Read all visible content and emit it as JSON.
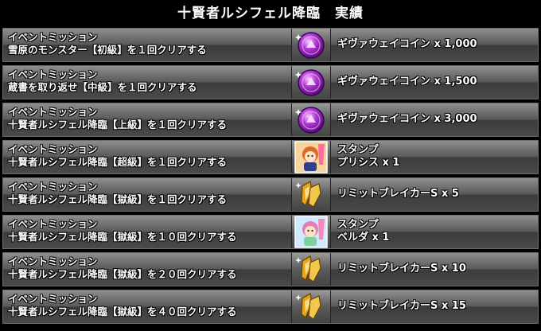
{
  "title": "十賢者ルシフェル降臨　実績",
  "rows": [
    {
      "line1": "イベントミッション",
      "line2": "雪原のモンスター【初級】を１回クリアする",
      "icon": "purple-coin-icon",
      "reward": [
        "ギヴァウェイコイン x 1,000"
      ]
    },
    {
      "line1": "イベントミッション",
      "line2": "蔵書を取り返せ【中級】を１回クリアする",
      "icon": "purple-coin-icon",
      "reward": [
        "ギヴァウェイコイン x 1,500"
      ]
    },
    {
      "line1": "イベントミッション",
      "line2": "十賢者ルシフェル降臨【上級】を１回クリアする",
      "icon": "purple-coin-icon",
      "reward": [
        "ギヴァウェイコイン x 3,000"
      ]
    },
    {
      "line1": "イベントミッション",
      "line2": "十賢者ルシフェル降臨【超級】を１回クリアする",
      "icon": "stamp-pricis-icon",
      "reward": [
        "スタンプ",
        "プリシス x 1"
      ]
    },
    {
      "line1": "イベントミッション",
      "line2": "十賢者ルシフェル降臨【獄級】を１回クリアする",
      "icon": "limit-breaker-icon",
      "reward": [
        "リミットブレイカーS x 5"
      ]
    },
    {
      "line1": "イベントミッション",
      "line2": "十賢者ルシフェル降臨【獄級】を１０回クリアする",
      "icon": "stamp-belda-icon",
      "reward": [
        "スタンプ",
        "ベルダ x 1"
      ]
    },
    {
      "line1": "イベントミッション",
      "line2": "十賢者ルシフェル降臨【獄級】を２０回クリアする",
      "icon": "limit-breaker-icon",
      "reward": [
        "リミットブレイカーS x 10"
      ]
    },
    {
      "line1": "イベントミッション",
      "line2": "十賢者ルシフェル降臨【獄級】を４０回クリアする",
      "icon": "limit-breaker-icon",
      "reward": [
        "リミットブレイカーS x 15"
      ]
    }
  ],
  "colors": {
    "coin": "#b23ad6",
    "breaker": "#e3a51c",
    "stamp_pricis": "#d96b2a",
    "stamp_belda": "#e27fb8"
  }
}
